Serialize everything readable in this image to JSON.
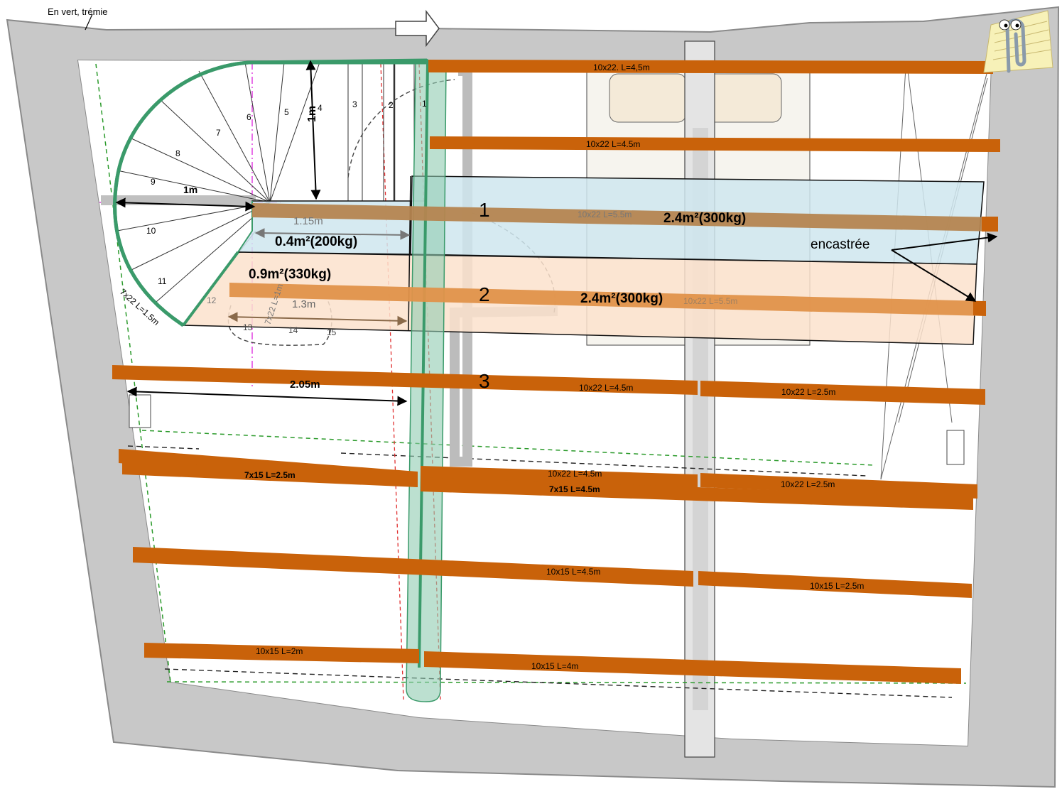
{
  "note": "En vert, trémie",
  "colors": {
    "wall": "#c8c8c8",
    "beam": "#c9620a",
    "beam_light": "#e0924a",
    "stair_outline": "#3a9a6a",
    "zone_blue": "#cfe6ee",
    "zone_orange": "#fbe2cc",
    "dashed_red": "#e03030",
    "dashed_green": "#2a9a2a",
    "magenta": "#e040e0"
  },
  "steps": [
    "1",
    "2",
    "3",
    "4",
    "5",
    "6",
    "7",
    "8",
    "9",
    "10",
    "11",
    "12",
    "13",
    "14",
    "15"
  ],
  "beams": {
    "b1": "10x22. L=4,5m",
    "b2": "10x22 L=4.5m",
    "b3": "10x22 L=5.5m",
    "b4": "10x22 L=5.5m",
    "b5": "10x22 L=4.5m",
    "b6": "10x22 L=2.5m",
    "b7": "7x15 L=2.5m",
    "b8": "10x22 L=4.5m",
    "b9": "7x15 L=4.5m",
    "b10": "10x22 L=2.5m",
    "b11": "10x15 L=4.5m",
    "b12": "10x15 L=2.5m",
    "b13": "10x15 L=2m",
    "b14": "10x15 L=4m",
    "b15": "7x22 L=1.5m",
    "b16": "7x22 L=1m"
  },
  "dimensions": {
    "d1m_horizontal": "1m",
    "d1m_vertical": "1m",
    "d115": "1.15m",
    "d13": "1.3m",
    "d205": "2.05m"
  },
  "zones": {
    "z1_number": "1",
    "z2_number": "2",
    "z3_number": "3",
    "area_small": "0.4m²(200kg)",
    "area_mid": "0.9m²(330kg)",
    "area_1": "2.4m²(300kg)",
    "area_2": "2.4m²(300kg)"
  },
  "callout": "encastrée"
}
